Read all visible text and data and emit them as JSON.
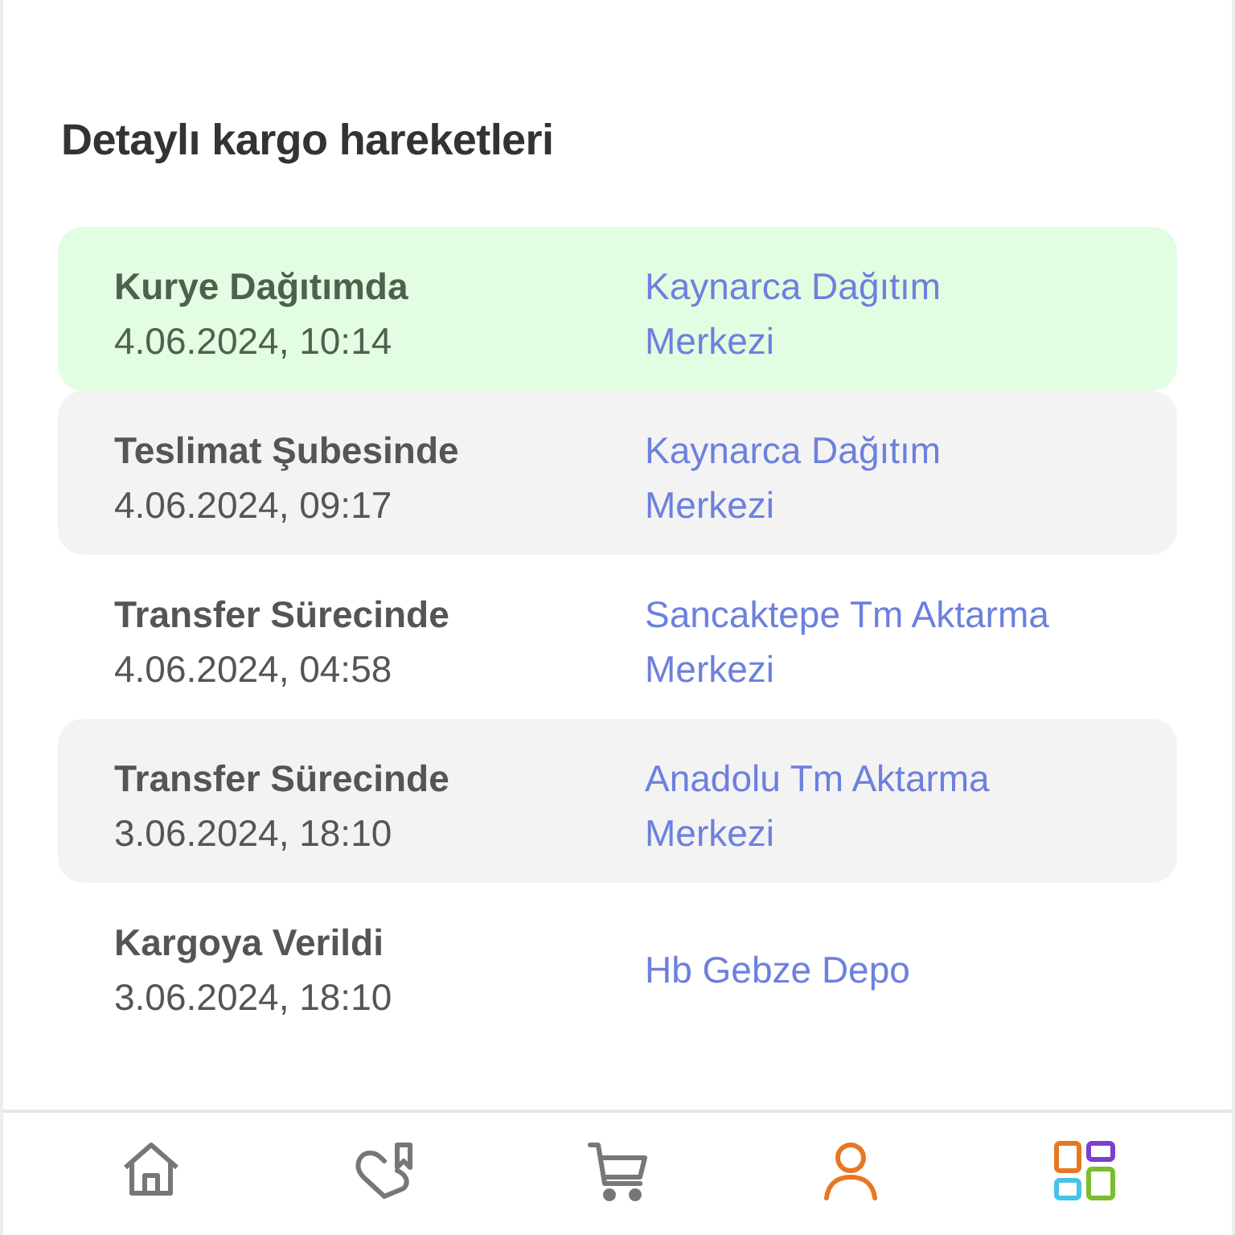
{
  "title": "Detaylı kargo hareketleri",
  "movements": [
    {
      "status": "Kurye Dağıtımda",
      "time": "4.06.2024, 10:14",
      "location": "Kaynarca Dağıtım Merkezi",
      "kind": "current"
    },
    {
      "status": "Teslimat Şubesinde",
      "time": "4.06.2024, 09:17",
      "location": "Kaynarca Dağıtım Merkezi",
      "kind": "shaded"
    },
    {
      "status": "Transfer Sürecinde",
      "time": "4.06.2024, 04:58",
      "location": "Sancaktepe Tm Aktarma Merkezi",
      "kind": "plain"
    },
    {
      "status": "Transfer Sürecinde",
      "time": "3.06.2024, 18:10",
      "location": "Anadolu Tm Aktarma Merkezi",
      "kind": "shaded"
    },
    {
      "status": "Kargoya Verildi",
      "time": "3.06.2024, 18:10",
      "location": "Hb Gebze Depo",
      "kind": "plain"
    }
  ],
  "nav": [
    {
      "kind": "home",
      "selected": false
    },
    {
      "kind": "favorites",
      "selected": false
    },
    {
      "kind": "cart",
      "selected": false
    },
    {
      "kind": "account",
      "selected": true
    },
    {
      "kind": "categories",
      "selected": false
    }
  ]
}
